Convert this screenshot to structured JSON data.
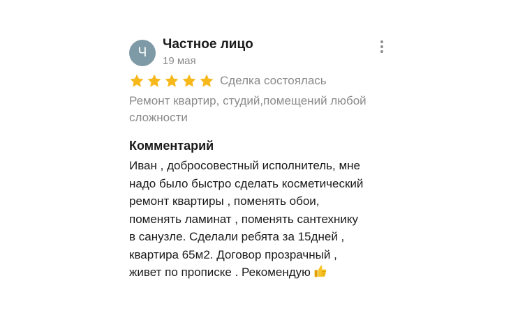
{
  "review": {
    "avatar_letter": "Ч",
    "author": "Частное лицо",
    "date": "19 мая",
    "rating": 5,
    "rating_max": 5,
    "deal_status": "Сделка состоялась",
    "service": "Ремонт квартир, студий,помещений любой сложности",
    "comment_title": "Комментарий",
    "comment_lines": [
      "Иван , добросовестный исполнитель, мне",
      "надо было быстро сделать косметический",
      "ремонт квартиры , поменять обои,",
      "поменять ламинат , поменять сантехнику",
      "в санузле. Сделали ребята за 15дней ,",
      "квартира 65м2.  Договор прозрачный ,",
      "живет по прописке . Рекомендую"
    ],
    "comment_end_icon": "thumbs-up-icon"
  },
  "colors": {
    "avatar_bg": "#7e9aa6",
    "star": "#f6b81a",
    "muted_text": "#8a8a8a",
    "primary_text": "#1a1a1a"
  }
}
